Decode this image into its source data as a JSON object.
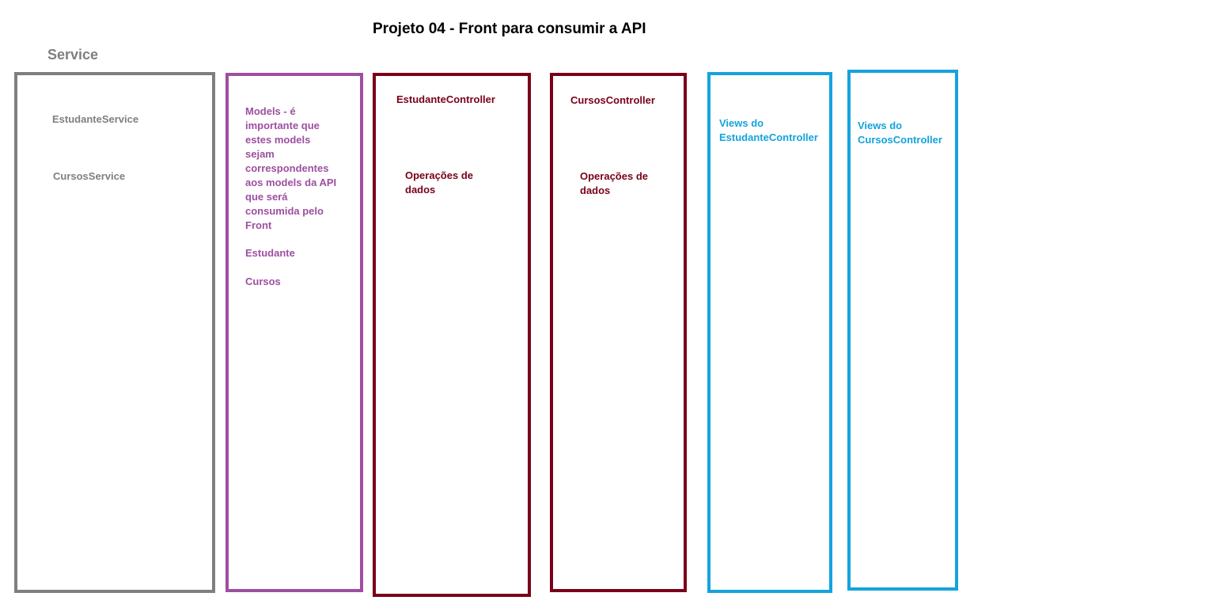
{
  "title": "Projeto 04 - Front para consumir a API",
  "service_heading": "Service",
  "service_box": {
    "items": [
      "EstudanteService",
      "CursosService"
    ]
  },
  "models_box": {
    "description": "Models - é importante que estes models sejam correspondentes aos models da API que será consumida pelo Front",
    "items": [
      "Estudante",
      "Cursos"
    ]
  },
  "estudante_controller_box": {
    "title": "EstudanteController",
    "body": "Operações de dados"
  },
  "cursos_controller_box": {
    "title": "CursosController",
    "body": "Operações de dados"
  },
  "views_estudante_box": {
    "title": "Views do EstudanteController"
  },
  "views_cursos_box": {
    "title": "Views do CursosController"
  },
  "colors": {
    "service": "#7f7f7f",
    "models": "#9e4fa0",
    "controller": "#7a0019",
    "views": "#14a3dc"
  }
}
